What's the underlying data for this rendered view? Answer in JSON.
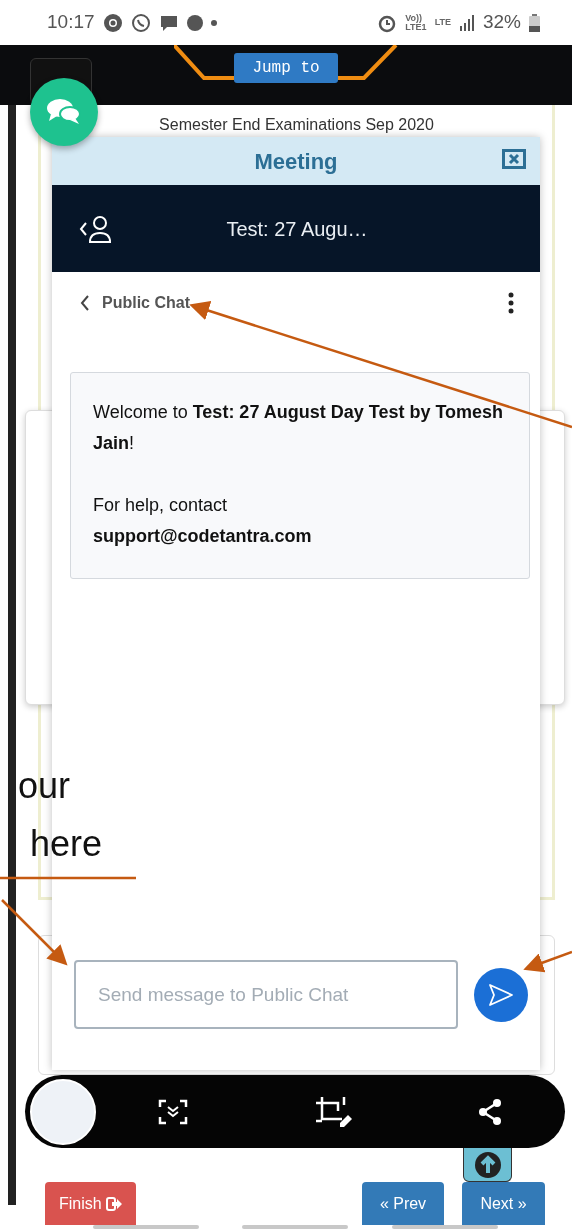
{
  "status_bar": {
    "time": "10:17",
    "network": [
      "Vo))",
      "LTE1",
      "LTE"
    ],
    "battery": "32%"
  },
  "header": {
    "jump_button": "Jump to"
  },
  "page": {
    "heading": "Semester End Examinations Sep 2020"
  },
  "meeting": {
    "title": "Meeting",
    "conversation": "Test: 27 Augu…",
    "chat_title": "Public Chat",
    "messages": [
      "Welcome to **Test: 27 August Day Test by Tomesh Jain**!",
      "For help, contact\n**support@codetantra.com**"
    ],
    "input": {
      "placeholder": "Send message to Public Chat"
    }
  },
  "annotation": {
    "lines": [
      "our",
      "here"
    ]
  },
  "footer": {
    "finish": "Finish",
    "prev": "« Prev",
    "next": "Next »"
  }
}
